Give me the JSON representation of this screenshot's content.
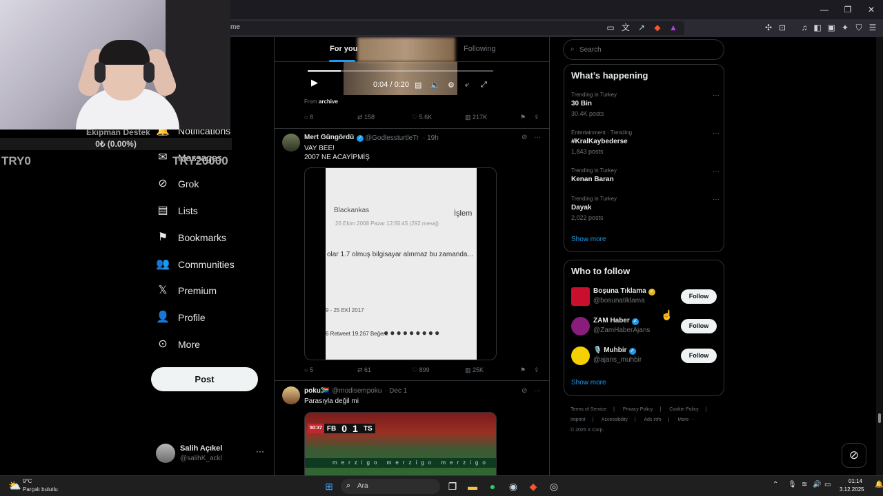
{
  "browser": {
    "address_text": "me",
    "window_controls": [
      "—",
      "❐",
      "✕"
    ]
  },
  "overlay": {
    "donation_title": "Ekipman Destek",
    "donation_progress": "0₺ (0.00%)",
    "donation_min": "TRY0",
    "donation_max": "TRY20000"
  },
  "nav": {
    "items": [
      {
        "label": "Notifications",
        "icon": "bell-icon"
      },
      {
        "label": "Messages",
        "icon": "envelope-icon"
      },
      {
        "label": "Grok",
        "icon": "grok-icon"
      },
      {
        "label": "Lists",
        "icon": "list-icon"
      },
      {
        "label": "Bookmarks",
        "icon": "bookmark-icon"
      },
      {
        "label": "Communities",
        "icon": "people-icon"
      },
      {
        "label": "Premium",
        "icon": "x-logo-icon"
      },
      {
        "label": "Profile",
        "icon": "person-icon"
      },
      {
        "label": "More",
        "icon": "more-circle-icon"
      }
    ],
    "post_label": "Post",
    "account_name": "Salih Açıkel",
    "account_handle": "@salihK_ackl",
    "account_more": "···"
  },
  "timeline": {
    "tab_for_you": "For you",
    "tab_following": "Following",
    "video": {
      "time": "0:04 / 0:20",
      "progress": 0.18,
      "from_label": "From",
      "from_source": "archive"
    },
    "tweet1_actions": {
      "replies": "8",
      "reposts": "158",
      "likes": "5.6K",
      "views": "217K"
    },
    "tweet2": {
      "name": "Mert Güngördü",
      "handle": "@GodlessturtleTr",
      "time": "· 19h",
      "text_line1": "VAY BEE!",
      "text_line2": "2007 NE ACAYİPMİŞ",
      "media": {
        "user": "Blackankas",
        "date": "26 Ekim 2008 Pazar 12:55:45 (292 mesaj)",
        "islem": "İşlem",
        "message": "olar 1.7 olmuş bilgisayar alınmaz bu zamanda...",
        "date2": "9 - 25 EKİ 2017",
        "stats": "6 Retweet   19.267 Beğeni"
      },
      "actions": {
        "replies": "5",
        "reposts": "61",
        "likes": "899",
        "views": "25K"
      }
    },
    "tweet3": {
      "name": "poku🇿🇦",
      "handle": "@modisempoku",
      "time": "· Dec 1",
      "text": "Parasıyla değil mi",
      "score": {
        "time": "50:37",
        "home": "FB",
        "home_goals": "0",
        "away_goals": "1",
        "away": "TS"
      },
      "board": "merzigo merzigo merzigo"
    }
  },
  "sidebar": {
    "search_placeholder": "Search",
    "happening_title": "What’s happening",
    "trends": [
      {
        "context": "Trending in Turkey",
        "title": "30 Bin",
        "count": "30.4K posts"
      },
      {
        "context": "Entertainment · Trending",
        "title": "#KralKaybederse",
        "count": "1,843 posts"
      },
      {
        "context": "Trending in Turkey",
        "title": "Kenan Baran",
        "count": ""
      },
      {
        "context": "Trending in Turkey",
        "title": "Dayak",
        "count": "2,022 posts"
      }
    ],
    "show_more": "Show more",
    "who_title": "Who to follow",
    "follow": [
      {
        "name": "Boşuna Tıklama",
        "handle": "@bosunatiklama",
        "button": "Follow",
        "avatar_color": "#c8102e"
      },
      {
        "name": "ZAM Haber",
        "handle": "@ZamHaberAjans",
        "button": "Follow",
        "avatar_color": "#8a1c7c"
      },
      {
        "name": "🎙️ Muhbir",
        "handle": "@ajans_muhbir",
        "button": "Follow",
        "avatar_color": "#f5d000"
      }
    ],
    "footer_links": [
      "Terms of Service",
      "|",
      "Privacy Policy",
      "|",
      "Cookie Policy",
      "|",
      "Imprint",
      "|",
      "Accessibility",
      "|",
      "Ads info",
      "|",
      "More ···"
    ],
    "copyright": "© 2025 X Corp."
  },
  "taskbar": {
    "weather_temp": "9°C",
    "weather_desc": "Parçalı bulutlu",
    "search_placeholder": "Ara",
    "time": "01:14",
    "date": "3.12.2025"
  },
  "colors": {
    "accent": "#1d9bf0",
    "bg": "#000000",
    "border": "#2f3336"
  }
}
